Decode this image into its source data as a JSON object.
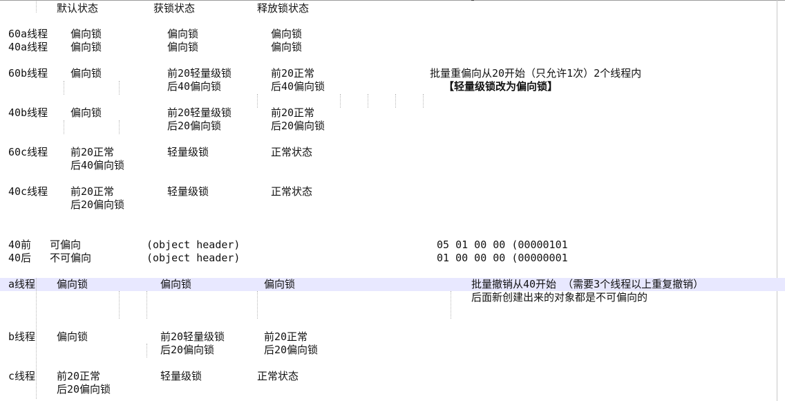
{
  "editor": {
    "rows": [
      {
        "cells": [
          "默认状态",
          "获锁状态",
          "释放锁状态"
        ]
      },
      {
        "cells": [
          "60a线程",
          "偏向锁",
          "偏向锁",
          "偏向锁"
        ]
      },
      {
        "cells": [
          "40a线程",
          "偏向锁",
          "偏向锁",
          "偏向锁"
        ]
      },
      {
        "cells": [
          "60b线程",
          "偏向锁",
          "前20轻量级锁",
          "前20正常",
          "批量重偏向从20开始（只允许1次）2个线程内"
        ]
      },
      {
        "cells": [
          "后40偏向锁",
          "后40偏向锁",
          "【轻量级锁改为偏向锁】"
        ]
      },
      {
        "cells": [
          "40b线程",
          "偏向锁",
          "前20轻量级锁",
          "前20正常"
        ]
      },
      {
        "cells": [
          "后20偏向锁",
          "后20偏向锁"
        ]
      },
      {
        "cells": [
          "60c线程",
          "前20正常",
          "轻量级锁",
          "正常状态"
        ]
      },
      {
        "cells": [
          "后40偏向锁"
        ]
      },
      {
        "cells": [
          "40c线程",
          "前20正常",
          "轻量级锁",
          "正常状态"
        ]
      },
      {
        "cells": [
          "后20偏向锁"
        ]
      },
      {
        "cells": [
          "40前",
          "可偏向",
          "(object header)",
          "05 01 00 00 (00000101"
        ]
      },
      {
        "cells": [
          "40后",
          "不可偏向",
          "(object header)",
          "01 00 00 00 (00000001"
        ]
      },
      {
        "cells": [
          "a线程",
          "偏向锁",
          "偏向锁",
          "偏向锁",
          "批量撤销从40开始 （需要3个线程以上重复撤销）"
        ]
      },
      {
        "cells": [
          "后面新创建出来的对象都是不可偏向的"
        ]
      },
      {
        "cells": [
          "b线程",
          "偏向锁",
          "前20轻量级锁",
          "前20正常"
        ]
      },
      {
        "cells": [
          "后20偏向锁",
          "后20偏向锁"
        ]
      },
      {
        "cells": [
          "c线程",
          "前20正常",
          "轻量级锁",
          "正常状态"
        ]
      },
      {
        "cells": [
          "后20偏向锁"
        ]
      }
    ]
  }
}
